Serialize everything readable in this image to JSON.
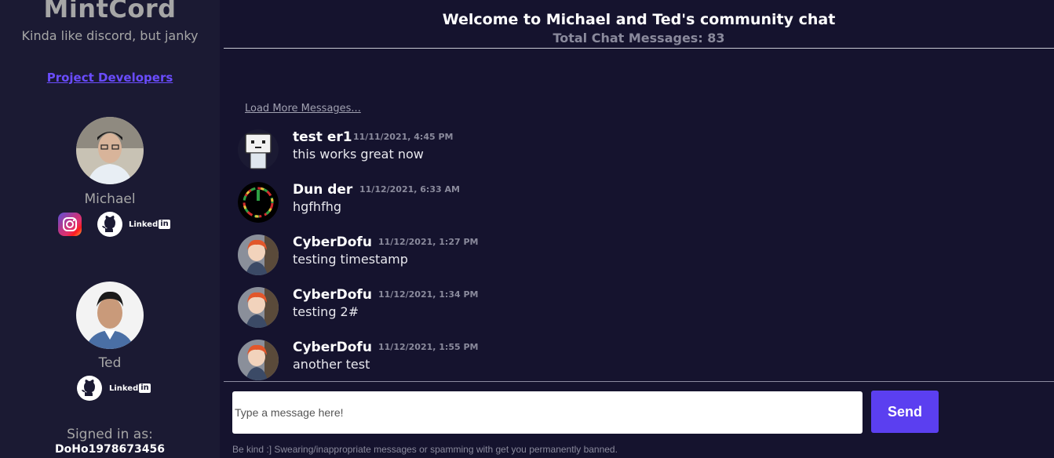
{
  "sidebar": {
    "brand": "MintCord",
    "tagline": "Kinda like discord, but janky",
    "developers_link": "Project Developers",
    "developers": [
      {
        "name": "Michael",
        "socials": [
          "instagram-icon",
          "github-icon",
          "linkedin-icon"
        ],
        "linkedin_label": "Linked",
        "linkedin_badge": "in"
      },
      {
        "name": "Ted",
        "socials": [
          "github-icon",
          "linkedin-icon"
        ],
        "linkedin_label": "Linked",
        "linkedin_badge": "in"
      }
    ],
    "signed_in_label": "Signed in as:",
    "signed_in_user": "DoHo1978673456"
  },
  "header": {
    "title": "Welcome to Michael and Ted's community chat",
    "message_count": "Total Chat Messages: 83"
  },
  "chat": {
    "load_more": "Load More Messages...",
    "messages": [
      {
        "user": "test er1",
        "time": "11/11/2021, 4:45 PM",
        "text": "this works great now",
        "avatar": "robot-avatar"
      },
      {
        "user": "Dun der",
        "time": "11/12/2021, 6:33 AM",
        "text": "hgfhfhg",
        "avatar": "ring-avatar"
      },
      {
        "user": "CyberDofu",
        "time": "11/12/2021, 1:27 PM",
        "text": "testing timestamp",
        "avatar": "anime-avatar"
      },
      {
        "user": "CyberDofu",
        "time": "11/12/2021, 1:34 PM",
        "text": "testing 2#",
        "avatar": "anime-avatar"
      },
      {
        "user": "CyberDofu",
        "time": "11/12/2021, 1:55 PM",
        "text": "another test",
        "avatar": "anime-avatar"
      }
    ]
  },
  "composer": {
    "placeholder": "Type a message here!",
    "send_label": "Send",
    "disclaimer": "Be kind :] Swearing/inappropriate messages or spamming with get you permanently banned."
  },
  "colors": {
    "background": "#15132e",
    "sidebar": "#1b1a33",
    "accent": "#5b3ff0",
    "link": "#6a4cff"
  }
}
